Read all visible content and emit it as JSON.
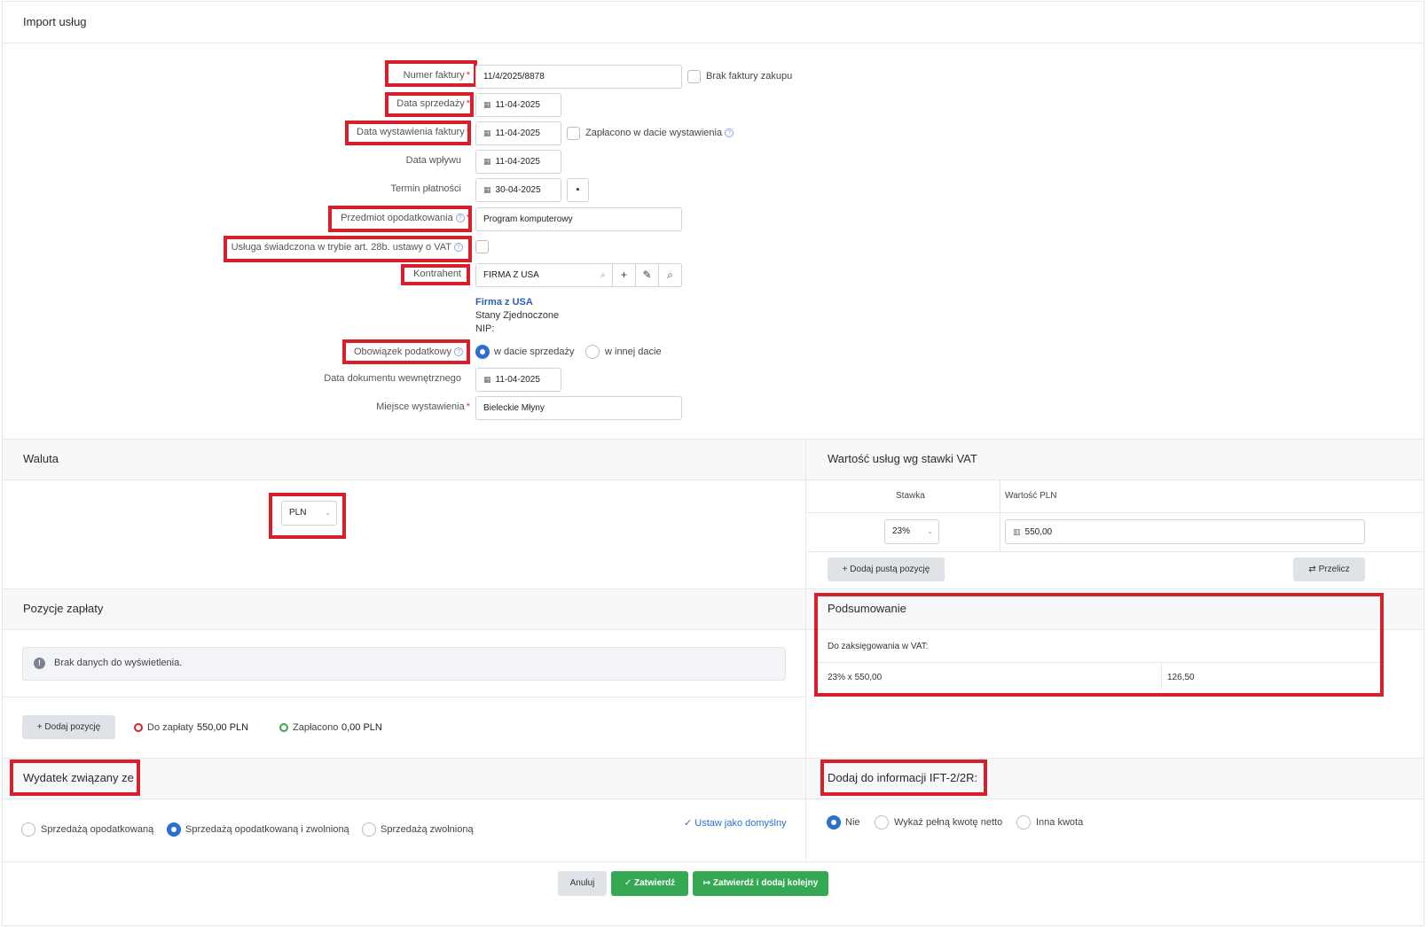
{
  "page_title": "Import usług",
  "form": {
    "invoice_number": {
      "label": "Numer faktury",
      "value": "11/4/2025/8878",
      "no_invoice_label": "Brak faktury zakupu"
    },
    "sale_date": {
      "label": "Data sprzedaży",
      "value": "11-04-2025"
    },
    "issue_date": {
      "label": "Data wystawienia faktury",
      "value": "11-04-2025",
      "paid_on_issue_label": "Zapłacono w dacie wystawienia"
    },
    "receipt_date": {
      "label": "Data wpływu",
      "value": "11-04-2025"
    },
    "payment_due": {
      "label": "Termin płatności",
      "value": "30-04-2025"
    },
    "tax_subject": {
      "label": "Przedmiot opodatkowania",
      "value": "Program komputerowy"
    },
    "art28b": {
      "label": "Usługa świadczona w trybie art. 28b. ustawy o VAT"
    },
    "contractor": {
      "label": "Kontrahent",
      "value": "FIRMA Z USA",
      "name": "Firma z USA",
      "country": "Stany Zjednoczone",
      "nip": "NIP:"
    },
    "tax_obligation": {
      "label": "Obowiązek podatkowy",
      "option1": "w dacie sprzedaży",
      "option2": "w innej dacie"
    },
    "internal_doc_date": {
      "label": "Data dokumentu wewnętrznego",
      "value": "11-04-2025"
    },
    "issue_place": {
      "label": "Miejsce wystawienia",
      "value": "Bieleckie Młyny"
    }
  },
  "currency": {
    "title": "Waluta",
    "value": "PLN"
  },
  "vat_values": {
    "title": "Wartość usług wg stawki VAT",
    "col_rate": "Stawka",
    "col_value": "Wartość PLN",
    "rate": "23%",
    "amount": "550,00",
    "add_button": "Dodaj pustą pozycję",
    "recalc_button": "Przelicz"
  },
  "payments": {
    "title": "Pozycje zapłaty",
    "empty": "Brak danych do wyświetlenia.",
    "add_button": "Dodaj pozycję",
    "to_pay_label": "Do zapłaty",
    "to_pay_value": "550,00 PLN",
    "paid_label": "Zapłacono",
    "paid_value": "0,00 PLN"
  },
  "summary": {
    "title": "Podsumowanie",
    "vat_label": "Do zaksięgowania w VAT:",
    "calc": "23% x 550,00",
    "result": "126,50"
  },
  "expense": {
    "title": "Wydatek związany ze",
    "option1": "Sprzedażą opodatkowaną",
    "option2": "Sprzedażą opodatkowaną i zwolnioną",
    "option3": "Sprzedażą zwolnioną",
    "default_link": "Ustaw jako domyślny"
  },
  "ift": {
    "title": "Dodaj do informacji IFT-2/2R:",
    "option1": "Nie",
    "option2": "Wykaż pełną kwotę netto",
    "option3": "Inna kwota"
  },
  "footer": {
    "cancel": "Anuluj",
    "confirm": "Zatwierdź",
    "confirm_next": "Zatwierdź i dodaj kolejny"
  },
  "colors": {
    "accent": "#2c6fd1",
    "green": "#35a853",
    "highlight": "#d7202b"
  }
}
